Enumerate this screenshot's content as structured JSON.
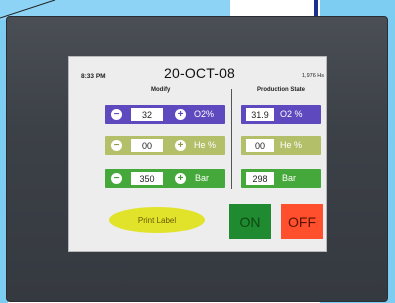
{
  "header": {
    "time": "8:33 PM",
    "date": "20-OCT-08",
    "hours": "1,976 Hs",
    "modify_label": "Modify",
    "production_label": "Production State"
  },
  "modify": [
    {
      "minus": "−",
      "value": "32",
      "plus": "+",
      "unit": "O2%"
    },
    {
      "minus": "−",
      "value": "00",
      "plus": "+",
      "unit": "He %"
    },
    {
      "minus": "−",
      "value": "350",
      "plus": "+",
      "unit": "Bar"
    }
  ],
  "production": [
    {
      "value": "31.9",
      "unit": "O2 %"
    },
    {
      "value": "00",
      "unit": "He %"
    },
    {
      "value": "298",
      "unit": "Bar"
    }
  ],
  "buttons": {
    "print": "Print Label",
    "on": "ON",
    "off": "OFF"
  },
  "colors": {
    "o2": "#5e49bf",
    "he": "#b4bf6a",
    "bar": "#45a83a",
    "on": "#1f8a2f",
    "off": "#ff4f2c",
    "print": "#e1e32a"
  }
}
